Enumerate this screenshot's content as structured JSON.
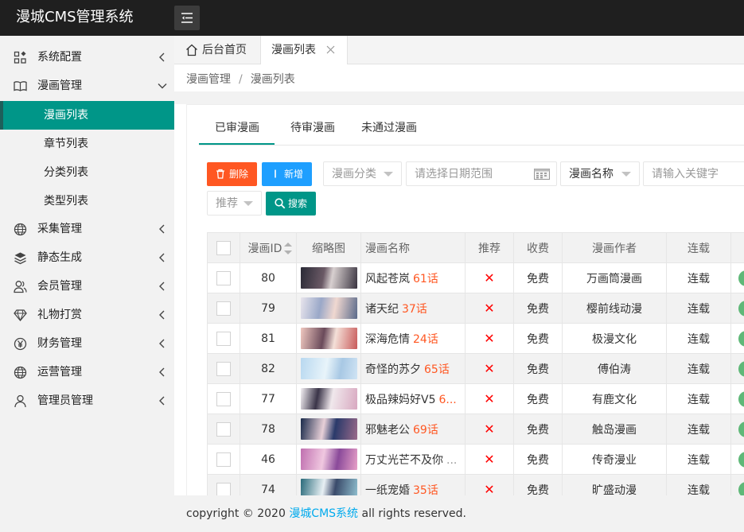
{
  "app": {
    "title": "漫城CMS管理系统"
  },
  "sidebar": {
    "items": [
      {
        "label": "系统配置",
        "icon": "grid-icon"
      },
      {
        "label": "漫画管理",
        "icon": "book-icon"
      },
      {
        "label": "采集管理",
        "icon": "globe-icon"
      },
      {
        "label": "静态生成",
        "icon": "layers-icon"
      },
      {
        "label": "会员管理",
        "icon": "users-icon"
      },
      {
        "label": "礼物打赏",
        "icon": "diamond-icon"
      },
      {
        "label": "财务管理",
        "icon": "yen-icon"
      },
      {
        "label": "运营管理",
        "icon": "globe-icon"
      },
      {
        "label": "管理员管理",
        "icon": "user-icon"
      }
    ],
    "submenu": [
      "漫画列表",
      "章节列表",
      "分类列表",
      "类型列表"
    ]
  },
  "tabs": {
    "home": "后台首页",
    "active": "漫画列表"
  },
  "breadcrumb": {
    "parent": "漫画管理",
    "current": "漫画列表"
  },
  "subtabs": [
    "已审漫画",
    "待审漫画",
    "未通过漫画"
  ],
  "toolbar": {
    "delete_label": "删除",
    "add_label": "新增",
    "search_label": "搜索",
    "category_placeholder": "漫画分类",
    "date_placeholder": "请选择日期范围",
    "field_select": "漫画名称",
    "keyword_placeholder": "请输入关键字",
    "recommend_placeholder": "推荐"
  },
  "table": {
    "headers": [
      "漫画ID",
      "缩略图",
      "漫画名称",
      "推荐",
      "收费",
      "漫画作者",
      "连载"
    ],
    "rows": [
      {
        "id": "80",
        "name": "风起苍岚",
        "episodes": "61话",
        "recommend": "✕",
        "fee": "免费",
        "author": "万画筒漫画",
        "status": "连载"
      },
      {
        "id": "79",
        "name": "诸天纪",
        "episodes": "37话",
        "recommend": "✕",
        "fee": "免费",
        "author": "樱前线动漫",
        "status": "连载"
      },
      {
        "id": "81",
        "name": "深海危情",
        "episodes": "24话",
        "recommend": "✕",
        "fee": "免费",
        "author": "极漫文化",
        "status": "连载"
      },
      {
        "id": "82",
        "name": "奇怪的苏夕",
        "episodes": "65话",
        "recommend": "✕",
        "fee": "免费",
        "author": "傅伯涛",
        "status": "连载"
      },
      {
        "id": "77",
        "name": "极品辣妈好V5",
        "episodes": "6...",
        "recommend": "✕",
        "fee": "免费",
        "author": "有鹿文化",
        "status": "连载"
      },
      {
        "id": "78",
        "name": "邪魅老公",
        "episodes": "69话",
        "recommend": "✕",
        "fee": "免费",
        "author": "触岛漫画",
        "status": "连载"
      },
      {
        "id": "46",
        "name": "万丈光芒不及你",
        "episodes": "...",
        "recommend": "✕",
        "fee": "免费",
        "author": "传奇漫业",
        "status": "连载"
      },
      {
        "id": "74",
        "name": "一纸宠婚",
        "episodes": "35话",
        "recommend": "✕",
        "fee": "免费",
        "author": "旷盛动漫",
        "status": "连载"
      }
    ]
  },
  "footer": {
    "prefix": "copyright © 2020",
    "link": "漫城CMS系统",
    "suffix": "all rights reserved."
  },
  "colors": {
    "accent": "#009688",
    "danger": "#ff5722",
    "primary": "#1e9fff",
    "link": "#01aaed"
  }
}
